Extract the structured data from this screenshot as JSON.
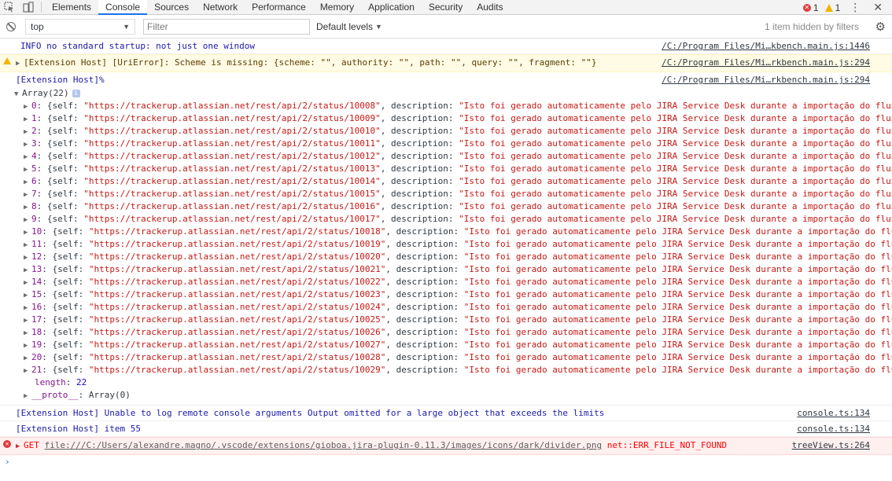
{
  "tabs": [
    "Elements",
    "Console",
    "Sources",
    "Network",
    "Performance",
    "Memory",
    "Application",
    "Security",
    "Audits"
  ],
  "active_tab": "Console",
  "counts": {
    "errors": "1",
    "warnings": "1"
  },
  "toolbar": {
    "context": "top",
    "filter_placeholder": "Filter",
    "levels": "Default levels",
    "hidden": "1 item hidden by filters"
  },
  "messages": {
    "info": {
      "text": "INFO no standard startup: not just one window",
      "source": "/C:/Program Files/Mi…kbench.main.js:1446"
    },
    "warn": {
      "text": "[Extension Host] [UriError]: Scheme is missing: {scheme: \"\", authority: \"\", path: \"\", query: \"\", fragment: \"\"}",
      "source": "/C:/Program Files/Mi…rkbench.main.js:294"
    },
    "host": {
      "text": "[Extension Host]%",
      "source": "/C:/Program Files/Mi…rkbench.main.js:294"
    },
    "array_label": "Array(22)",
    "row_prefix": "{self: ",
    "row_url_base": "\"https://trackerup.atlassian.net/rest/api/2/status/",
    "row_mid": ", description: ",
    "row_desc": "\"Isto foi gerado automaticamente pelo JIRA Service Desk durante a importação do fluxo",
    "row_start_id": 10008,
    "row_count": 22,
    "length_label": "length",
    "length_value": "22",
    "proto_label": "__proto__",
    "proto_value": "Array(0)",
    "unable": {
      "text": "[Extension Host] Unable to log remote console arguments Output omitted for a large object that exceeds the limits",
      "source": "console.ts:134"
    },
    "item": {
      "text": "[Extension Host] item 55",
      "source": "console.ts:134"
    },
    "error": {
      "method": "GET",
      "url": "file:///C:/Users/alexandre.magno/.vscode/extensions/gioboa.jira-plugin-0.11.3/images/icons/dark/divider.png",
      "err": "net::ERR_FILE_NOT_FOUND",
      "source": "treeView.ts:264"
    }
  },
  "prompt": "›"
}
